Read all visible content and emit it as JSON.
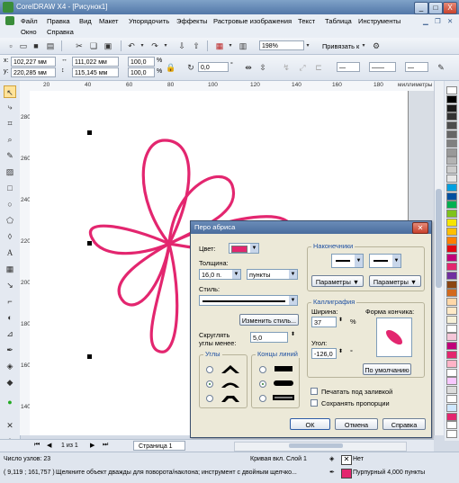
{
  "app": {
    "title": "CorelDRAW X4 - [Рисунок1]",
    "min": "_",
    "max": "□",
    "close": "X"
  },
  "menu": {
    "items": [
      "Файл",
      "Правка",
      "Вид",
      "Макет",
      "Упорядочить",
      "Эффекты",
      "Растровые изображения",
      "Текст",
      "Таблица",
      "Инструменты"
    ],
    "row2": [
      "Окно",
      "Справка"
    ]
  },
  "toolbar": {
    "zoom": "198%",
    "snap": "Привязать к"
  },
  "properties": {
    "x": "102,227 мм",
    "y": "220,285 мм",
    "w": "111,022 мм",
    "h": "115,145 мм",
    "sx": "100,0",
    "sy": "100,0",
    "pct": "%",
    "angle": "0,0",
    "deg": "°"
  },
  "ruler": {
    "h_ticks": [
      "20",
      "40",
      "60",
      "80",
      "100",
      "120",
      "140",
      "160",
      "180"
    ],
    "v_ticks": [
      "280",
      "260",
      "240",
      "220",
      "200",
      "180",
      "160",
      "140"
    ],
    "h_unit": "миллиметры",
    "v_unit": "миллиметры"
  },
  "pagenav": {
    "counter": "1 из 1",
    "tab": "Страница 1"
  },
  "status": {
    "nodes": "Число узлов: 23",
    "curve": "Кривая вкл. Слой 1",
    "coords": "( 9,119 ; 161,757 )",
    "hint": "Щелкните объект дважды для поворота/наклона; инструмент с двойным щелчко...",
    "fill_none": "Нет",
    "outline": "Пурпурный 4,000 пункты"
  },
  "dialog": {
    "title": "Перо абриса",
    "color_label": "Цвет:",
    "thickness_label": "Толщина:",
    "thickness_value": "16,0 п.",
    "thickness_unit": "пункты",
    "style_label": "Стиль:",
    "edit_style_button": "Изменить стиль...",
    "round_label_1": "Скруглять",
    "round_label_2": "углы менее:",
    "round_value": "5,0",
    "corners_group": "Углы",
    "caps_group": "Концы линий",
    "arrows_group": "Наконечники",
    "params_left": "Параметры",
    "params_right": "Параметры",
    "calligraphy_group": "Каллиграфия",
    "width_label": "Ширина:",
    "width_value": "37",
    "width_unit": "%",
    "angle_label": "Угол:",
    "angle_value": "-126,0",
    "angle_unit": "°",
    "nib_shape_label": "Форма кончика:",
    "default_button": "По умолчанию",
    "behind_fill": "Печатать под заливкой",
    "scale_with_image": "Сохранять пропорции",
    "ok": "ОК",
    "cancel": "Отмена",
    "help": "Справка"
  },
  "colors": {
    "accent": "#e3266f",
    "curve": "#e3266f"
  },
  "palette": [
    "#ffffff",
    "#000000",
    "#1a1a1a",
    "#333333",
    "#4d4d4d",
    "#666666",
    "#808080",
    "#999999",
    "#b3b3b3",
    "#cccccc",
    "#e6e6e6",
    "#00a0e0",
    "#0050a0",
    "#00b050",
    "#7fc31c",
    "#f6e500",
    "#ffbf00",
    "#ff7f00",
    "#e30613",
    "#c0007a",
    "#e3266f",
    "#7030a0",
    "#8b4513",
    "#d2691e",
    "#ffd7a8",
    "#ffe9c7",
    "#f6f0d8",
    "#ffffff",
    "#f4c6d8",
    "#c0007a",
    "#e3266f",
    "#ffb3c7",
    "#ffffff",
    "#f8c8ff",
    "#dcdcdc",
    "#ffffff",
    "#cfe8ff",
    "#e3266f",
    "#ffffff",
    "#ffffff"
  ]
}
